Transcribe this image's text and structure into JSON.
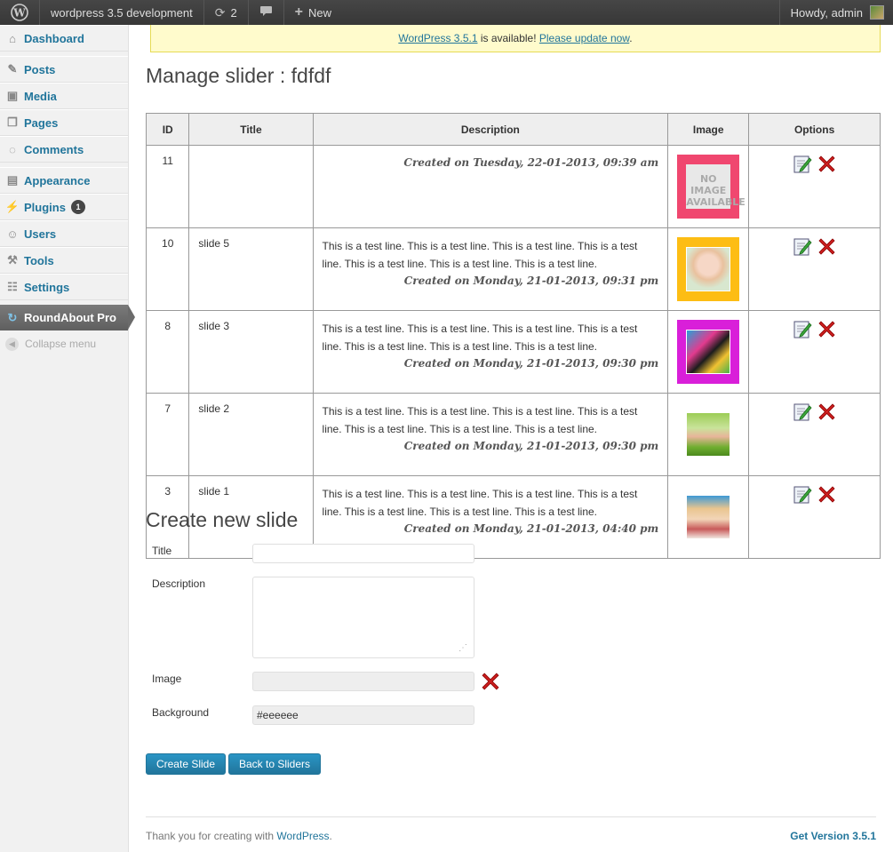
{
  "adminbar": {
    "site_name": "wordpress 3.5 development",
    "updates_count": "2",
    "new_label": "New",
    "howdy": "Howdy, admin"
  },
  "sidebar": {
    "items": [
      {
        "label": "Dashboard",
        "icon": "dashboard-icon"
      },
      {
        "label": "Posts",
        "icon": "posts-icon"
      },
      {
        "label": "Media",
        "icon": "media-icon"
      },
      {
        "label": "Pages",
        "icon": "pages-icon"
      },
      {
        "label": "Comments",
        "icon": "comments-icon"
      },
      {
        "label": "Appearance",
        "icon": "appearance-icon"
      },
      {
        "label": "Plugins",
        "icon": "plugins-icon",
        "badge": "1"
      },
      {
        "label": "Users",
        "icon": "users-icon"
      },
      {
        "label": "Tools",
        "icon": "tools-icon"
      },
      {
        "label": "Settings",
        "icon": "settings-icon"
      },
      {
        "label": "RoundAbout Pro",
        "icon": "roundabout-icon"
      }
    ],
    "collapse_label": "Collapse menu"
  },
  "notice": {
    "link1": "WordPress 3.5.1",
    "text": " is available! ",
    "link2": "Please update now",
    "tail": "."
  },
  "page_title": "Manage slider : fdfdf",
  "table": {
    "headers": [
      "ID",
      "Title",
      "Description",
      "Image",
      "Options"
    ],
    "rows": [
      {
        "id": "11",
        "title": "",
        "desc": "",
        "created": "Created on Tuesday, 22-01-2013, 09:39 am",
        "bg": "#f0476f",
        "thumb": "noimage"
      },
      {
        "id": "10",
        "title": "slide 5",
        "desc": "This is a test line. This is a test line. This is a test line. This is a test line. This is a test line. This is a test line. This is a test line.",
        "created": "Created on Monday, 21-01-2013, 09:31 pm",
        "bg": "#fdbd14",
        "thumb": "baby"
      },
      {
        "id": "8",
        "title": "slide 3",
        "desc": "This is a test line. This is a test line. This is a test line. This is a test line. This is a test line. This is a test line. This is a test line.",
        "created": "Created on Monday, 21-01-2013, 09:30 pm",
        "bg": "#d91fd9",
        "thumb": "girl-graffiti"
      },
      {
        "id": "7",
        "title": "slide 2",
        "desc": "This is a test line. This is a test line. This is a test line. This is a test line. This is a test line. This is a test line. This is a test line.",
        "created": "Created on Monday, 21-01-2013, 09:30 pm",
        "bg": "#ffffff",
        "thumb": "child-grass"
      },
      {
        "id": "3",
        "title": "slide 1",
        "desc": "This is a test line. This is a test line. This is a test line. This is a test line. This is a test line. This is a test line. This is a test line.",
        "created": "Created on Monday, 21-01-2013, 04:40 pm",
        "bg": "#ffffff",
        "thumb": "blonde-woman"
      }
    ]
  },
  "noimage_text": "NO IMAGE AVAILABLE",
  "form": {
    "section_title": "Create new slide",
    "title_label": "Title",
    "title_value": "",
    "description_label": "Description",
    "description_value": "",
    "image_label": "Image",
    "image_value": "",
    "background_label": "Background",
    "background_value": "#eeeeee",
    "create_button": "Create Slide",
    "back_button": "Back to Sliders"
  },
  "footer": {
    "thanks": "Thank you for creating with ",
    "wp_link": "WordPress",
    "dot": ".",
    "version": "Get Version 3.5.1"
  },
  "colors": {
    "link": "#21759b",
    "button": "#21759b",
    "delete": "#cc1f1f"
  }
}
